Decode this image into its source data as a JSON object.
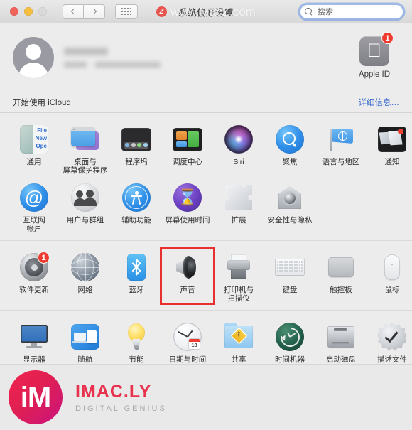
{
  "window": {
    "title": "系统偏好设置",
    "traffic_lights": [
      "close",
      "minimize",
      "zoom-disabled"
    ]
  },
  "toolbar": {
    "back_label": "后退",
    "forward_label": "前进",
    "show_all_label": "显示全部",
    "search": {
      "placeholder": "搜索",
      "value": ""
    }
  },
  "watermark_title": {
    "badge": "Z",
    "text": "www.MacZ.com"
  },
  "account": {
    "name_redacted": true,
    "subtitle_redacted": true,
    "apple_id": {
      "label": "Apple ID",
      "badge": "1",
      "icon": "apple-logo-icon"
    }
  },
  "icloud": {
    "label": "开始使用 iCloud",
    "link": "详细信息…"
  },
  "sections": [
    {
      "rows": [
        [
          {
            "label": "通用",
            "icon": "general-icon"
          },
          {
            "label": "桌面与\n屏幕保护程序",
            "icon": "desktop-screensaver-icon"
          },
          {
            "label": "程序坞",
            "icon": "dock-icon"
          },
          {
            "label": "调度中心",
            "icon": "mission-control-icon"
          },
          {
            "label": "Siri",
            "icon": "siri-icon"
          },
          {
            "label": "聚焦",
            "icon": "spotlight-icon"
          },
          {
            "label": "语言与地区",
            "icon": "language-region-icon"
          },
          {
            "label": "通知",
            "icon": "notifications-icon"
          }
        ],
        [
          {
            "label": "互联网\n帐户",
            "icon": "internet-accounts-icon"
          },
          {
            "label": "用户与群组",
            "icon": "users-groups-icon"
          },
          {
            "label": "辅助功能",
            "icon": "accessibility-icon"
          },
          {
            "label": "屏幕使用时间",
            "icon": "screen-time-icon"
          },
          {
            "label": "扩展",
            "icon": "extensions-icon"
          },
          {
            "label": "安全性与隐私",
            "icon": "security-privacy-icon"
          }
        ]
      ]
    },
    {
      "rows": [
        [
          {
            "label": "软件更新",
            "icon": "software-update-icon",
            "badge": "1"
          },
          {
            "label": "网络",
            "icon": "network-icon"
          },
          {
            "label": "蓝牙",
            "icon": "bluetooth-icon"
          },
          {
            "label": "声音",
            "icon": "sound-icon",
            "highlighted": true
          },
          {
            "label": "打印机与\n扫描仪",
            "icon": "printers-scanners-icon"
          },
          {
            "label": "键盘",
            "icon": "keyboard-icon"
          },
          {
            "label": "触控板",
            "icon": "trackpad-icon"
          },
          {
            "label": "鼠标",
            "icon": "mouse-icon"
          }
        ]
      ]
    },
    {
      "rows": [
        [
          {
            "label": "显示器",
            "icon": "displays-icon"
          },
          {
            "label": "随航",
            "icon": "sidecar-icon"
          },
          {
            "label": "节能",
            "icon": "energy-saver-icon"
          },
          {
            "label": "日期与时间",
            "icon": "date-time-icon",
            "day": "18"
          },
          {
            "label": "共享",
            "icon": "sharing-icon"
          },
          {
            "label": "时间机器",
            "icon": "time-machine-icon"
          },
          {
            "label": "启动磁盘",
            "icon": "startup-disk-icon"
          },
          {
            "label": "描述文件",
            "icon": "profiles-icon"
          }
        ]
      ]
    }
  ],
  "footer_watermark": {
    "mark": "iM",
    "title": "IMAC.LY",
    "subtitle": "DIGITAL GENIUS"
  },
  "colors": {
    "accent_link": "#3c6bd0",
    "badge_red": "#ee3b30",
    "highlight_red": "#e8302e",
    "watermark_pink": "#e8334f"
  }
}
